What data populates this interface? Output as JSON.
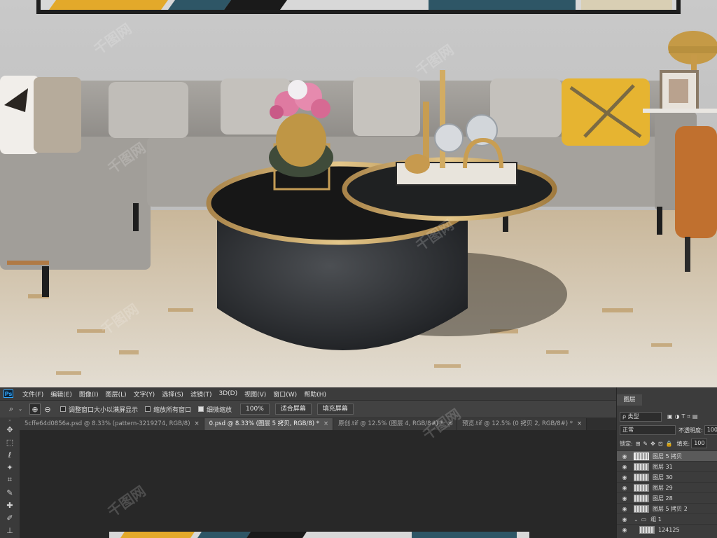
{
  "menu": {
    "logo": "Ps",
    "items": [
      "文件(F)",
      "编辑(E)",
      "图像(I)",
      "图层(L)",
      "文字(Y)",
      "选择(S)",
      "滤镜(T)",
      "3D(D)",
      "视图(V)",
      "窗口(W)",
      "帮助(H)"
    ]
  },
  "options": {
    "zoom_icon": "zoom-tool-icon",
    "resize_windows": "调整窗口大小以满屏显示",
    "zoom_all": "缩放所有窗口",
    "scrubby_zoom": "细微缩放",
    "btn_100": "100%",
    "btn_fit": "适合屏幕",
    "btn_fill": "填充屏幕",
    "scrubby_checked": true
  },
  "tabs": [
    {
      "label": "5cffe64d0856a.psd @ 8.33% (pattern-3219274, RGB/8)",
      "close": "×",
      "active": false
    },
    {
      "label": "0.psd @ 8.33% (图层 5 拷贝, RGB/8) *",
      "close": "×",
      "active": true
    },
    {
      "label": "原创.tif @ 12.5% (图层 4, RGB/8#) *",
      "close": "×",
      "active": false
    },
    {
      "label": "预览.tif @ 12.5% (0 拷贝 2, RGB/8#) *",
      "close": "×",
      "active": false
    }
  ],
  "layers_panel": {
    "title": "图层",
    "filter": "ρ 类型",
    "blend_mode": "正常",
    "opacity_label": "不透明度:",
    "opacity_value": "100",
    "lock_label": "锁定:",
    "fill_label": "填充:",
    "fill_value": "100",
    "layers": [
      {
        "name": "图层 5 拷贝",
        "selected": true,
        "type": "layer"
      },
      {
        "name": "图层 31",
        "selected": false,
        "type": "layer"
      },
      {
        "name": "图层 30",
        "selected": false,
        "type": "layer"
      },
      {
        "name": "图层 29",
        "selected": false,
        "type": "layer"
      },
      {
        "name": "图层 28",
        "selected": false,
        "type": "layer"
      },
      {
        "name": "图层 5 拷贝 2",
        "selected": false,
        "type": "layer"
      },
      {
        "name": "组 1",
        "selected": false,
        "type": "group"
      },
      {
        "name": "124125",
        "selected": false,
        "type": "layer"
      }
    ]
  },
  "tools": [
    "move-tool-icon",
    "marquee-tool-icon",
    "lasso-tool-icon",
    "magic-wand-icon",
    "crop-tool-icon",
    "eyedropper-icon",
    "healing-brush-icon",
    "brush-tool-icon",
    "clone-stamp-icon"
  ],
  "watermark": "千图网"
}
